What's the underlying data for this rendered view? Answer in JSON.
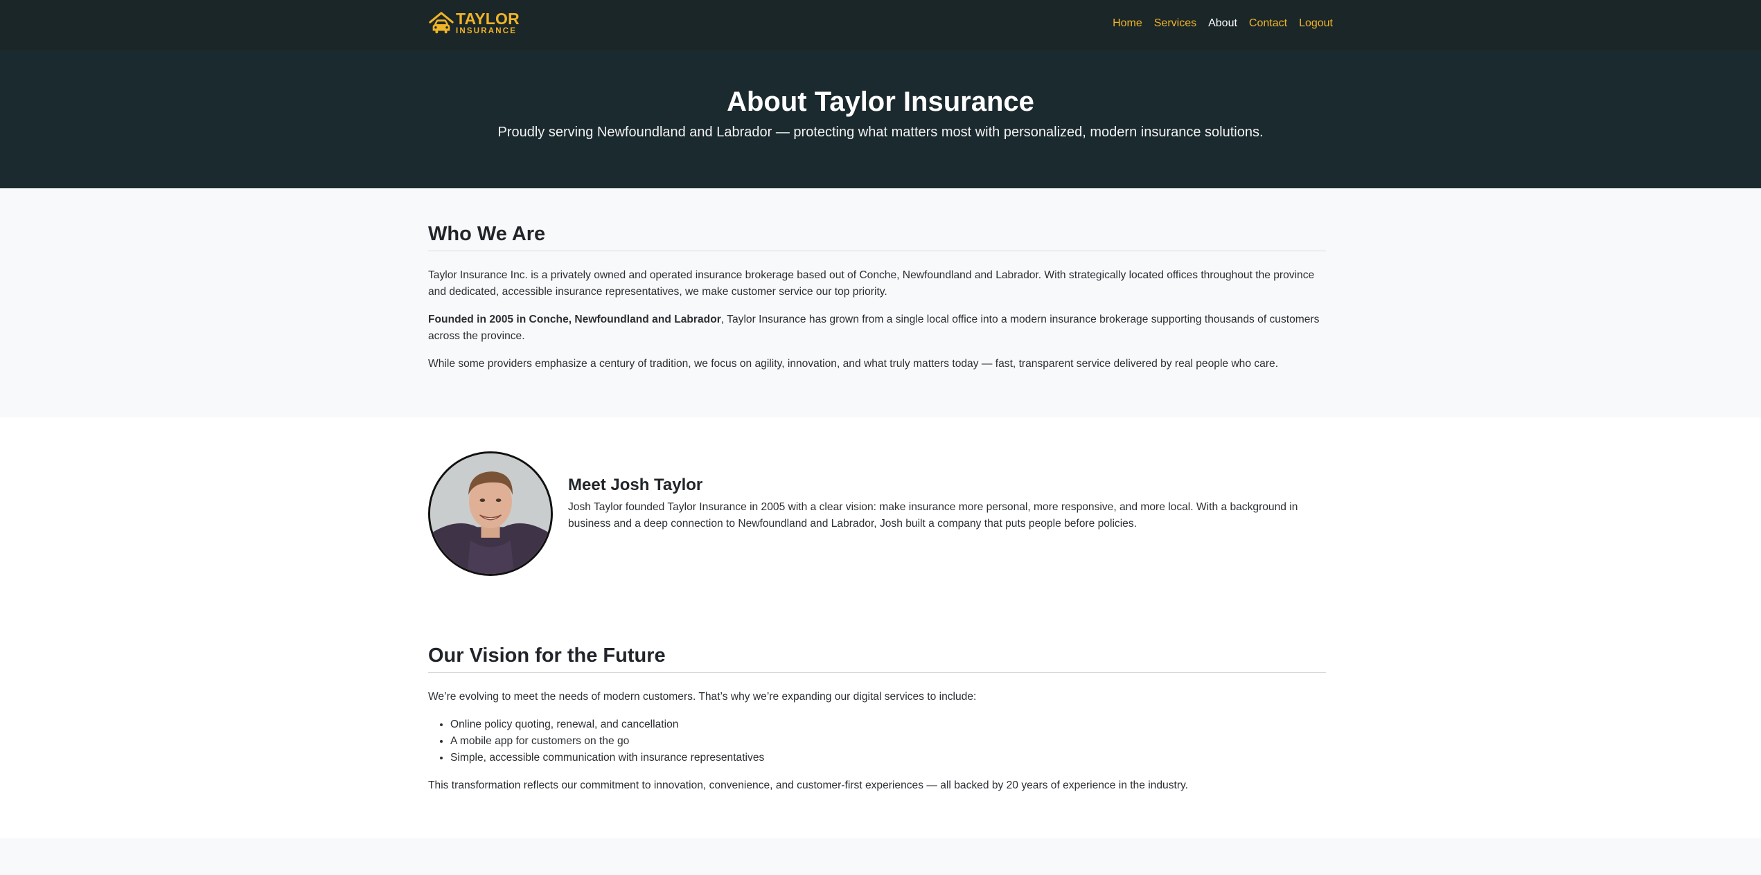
{
  "brand": {
    "title": "TAYLOR",
    "subtitle": "INSURANCE",
    "icon": "house-car-icon",
    "color": "#f0b428"
  },
  "nav": {
    "items": [
      {
        "label": "Home",
        "active": false
      },
      {
        "label": "Services",
        "active": false
      },
      {
        "label": "About",
        "active": true
      },
      {
        "label": "Contact",
        "active": false
      },
      {
        "label": "Logout",
        "active": false
      }
    ]
  },
  "hero": {
    "title": "About Taylor Insurance",
    "subtitle": "Proudly serving Newfoundland and Labrador — protecting what matters most with personalized, modern insurance solutions."
  },
  "who": {
    "title": "Who We Are",
    "p1": "Taylor Insurance Inc. is a privately owned and operated insurance brokerage based out of Conche, Newfoundland and Labrador. With strategically located offices throughout the province and dedicated, accessible insurance representatives, we make customer service our top priority.",
    "p2_bold": "Founded in 2005 in Conche, Newfoundland and Labrador",
    "p2_rest": ", Taylor Insurance has grown from a single local office into a modern insurance brokerage supporting thousands of customers across the province.",
    "p3": "While some providers emphasize a century of tradition, we focus on agility, innovation, and what truly matters today — fast, transparent service delivered by real people who care."
  },
  "meet": {
    "title": "Meet Josh Taylor",
    "text": "Josh Taylor founded Taylor Insurance in 2005 with a clear vision: make insurance more personal, more responsive, and more local. With a background in business and a deep connection to Newfoundland and Labrador, Josh built a company that puts people before policies."
  },
  "vision": {
    "title": "Our Vision for the Future",
    "intro": "We’re evolving to meet the needs of modern customers. That’s why we’re expanding our digital services to include:",
    "items": [
      "Online policy quoting, renewal, and cancellation",
      "A mobile app for customers on the go",
      "Simple, accessible communication with insurance representatives"
    ],
    "outro": "This transformation reflects our commitment to innovation, convenience, and customer-first experiences — all backed by 20 years of experience in the industry."
  }
}
